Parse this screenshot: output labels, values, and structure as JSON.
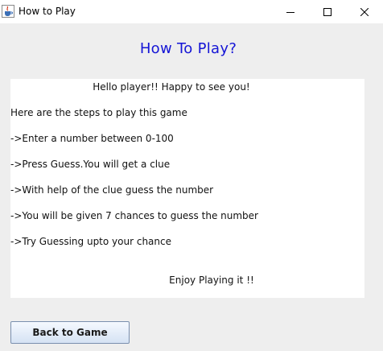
{
  "window": {
    "title": "How to Play",
    "icon": "java-cup-icon",
    "controls": [
      "minimize-icon",
      "maximize-icon",
      "close-icon"
    ]
  },
  "heading": "How To Play?",
  "heading_color": "#1515d6",
  "instructions": {
    "greeting": "Hello player!! Happy to see you!",
    "intro": "Here are the steps to play this game",
    "step1": "->Enter a number between 0-100",
    "step2": "->Press Guess.You will get a clue",
    "step3": "->With help of the clue guess the number",
    "step4": "->You will be given 7 chances to guess the number",
    "step5": "->Try Guessing upto your chance",
    "closing": "Enjoy Playing it !!"
  },
  "back_button": {
    "label": "Back to Game"
  }
}
